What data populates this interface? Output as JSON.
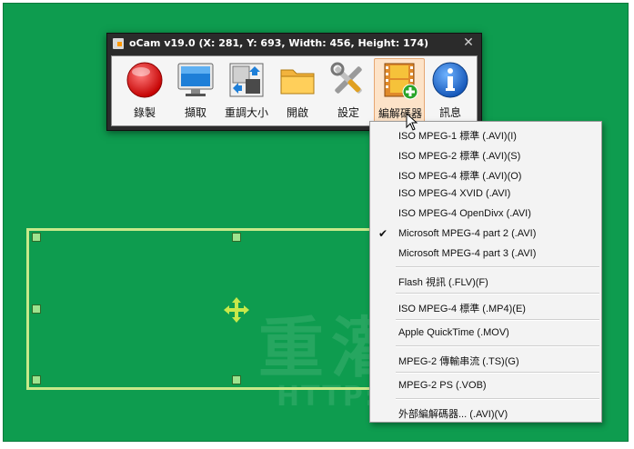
{
  "window": {
    "title": "oCam v19.0 (X: 281, Y: 693, Width: 456, Height: 174)",
    "close": "✕"
  },
  "toolbar": [
    {
      "label": "錄製",
      "icon": "record-icon"
    },
    {
      "label": "擷取",
      "icon": "monitor-icon"
    },
    {
      "label": "重調大小",
      "icon": "resize-icon"
    },
    {
      "label": "開啟",
      "icon": "folder-icon"
    },
    {
      "label": "設定",
      "icon": "tools-icon"
    },
    {
      "label": "編解碼器",
      "icon": "codec-icon",
      "active": true
    },
    {
      "label": "訊息",
      "icon": "info-icon"
    }
  ],
  "menu": {
    "items": [
      {
        "label": "ISO MPEG-1 標準 (.AVI)(I)",
        "checked": false
      },
      {
        "label": "ISO MPEG-2 標準 (.AVI)(S)",
        "checked": false
      },
      {
        "label": "ISO MPEG-4 標準 (.AVI)(O)",
        "checked": false
      },
      {
        "label": "ISO MPEG-4 XVID (.AVI)",
        "checked": false
      },
      {
        "label": "ISO MPEG-4 OpenDivx (.AVI)",
        "checked": false
      },
      {
        "label": "Microsoft MPEG-4 part 2 (.AVI)",
        "checked": true
      },
      {
        "label": "Microsoft MPEG-4 part 3 (.AVI)",
        "checked": false
      },
      {
        "label": "Flash 視訊 (.FLV)(F)",
        "checked": false
      },
      {
        "label": "ISO MPEG-4 標準 (.MP4)(E)",
        "checked": false
      },
      {
        "label": "Apple QuickTime (.MOV)",
        "checked": false
      },
      {
        "label": "MPEG-2 傳輸串流 (.TS)(G)",
        "checked": false
      },
      {
        "label": "MPEG-2 PS (.VOB)",
        "checked": false
      },
      {
        "label": "外部編解碼器... (.AVI)(V)",
        "checked": false
      }
    ],
    "checkmark": "✔"
  },
  "watermark": {
    "text": "重灌狂人",
    "url": "HTTP://BRIIAN.COM"
  },
  "colors": {
    "desktop": "#0e9c4f",
    "region_border": "#c7e98a",
    "active_tool": "#fde3c8"
  }
}
